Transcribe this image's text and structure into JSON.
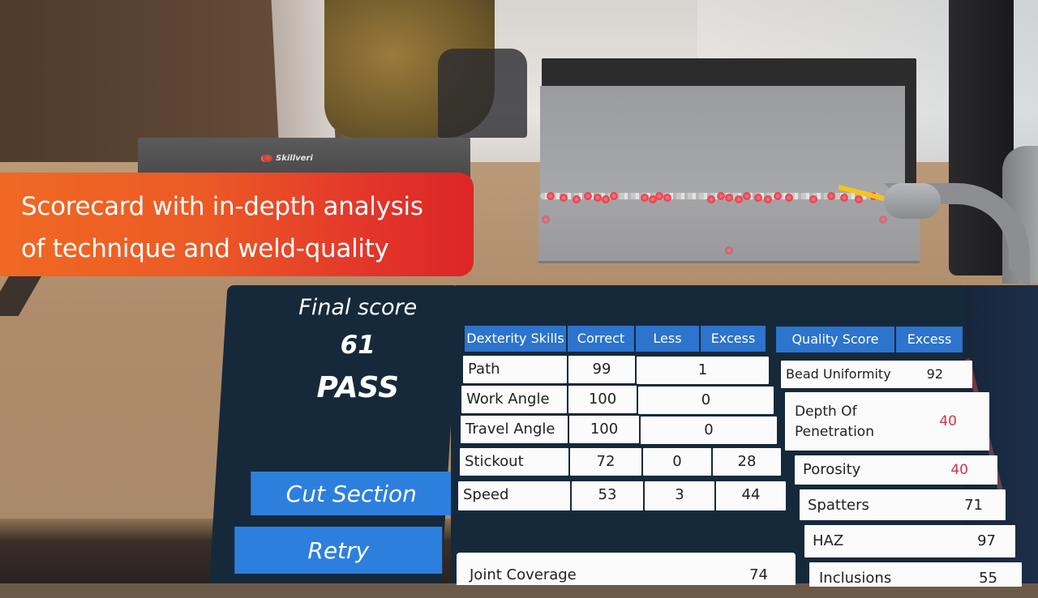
{
  "caption": {
    "line1": "Scorecard with in-depth analysis",
    "line2": "of technique and weld-quality"
  },
  "brand": {
    "name": "Skillveri"
  },
  "score_panel": {
    "label": "Final score",
    "value": "61",
    "result": "PASS",
    "buttons": {
      "cut_section": "Cut Section",
      "retry": "Retry"
    }
  },
  "dexterity": {
    "headers": [
      "Dexterity Skills",
      "Correct",
      "Less",
      "Excess"
    ],
    "rows": [
      {
        "skill": "Path",
        "correct": "99",
        "deviation": "1"
      },
      {
        "skill": "Work Angle",
        "correct": "100",
        "deviation": "0"
      },
      {
        "skill": "Travel Angle",
        "correct": "100",
        "deviation": "0"
      },
      {
        "skill": "Stickout",
        "correct": "72",
        "less": "0",
        "excess": "28"
      },
      {
        "skill": "Speed",
        "correct": "53",
        "less": "3",
        "excess": "44"
      }
    ],
    "joint_coverage": {
      "label": "Joint Coverage",
      "value": "74"
    }
  },
  "quality": {
    "headers": [
      "Quality Score",
      "Excess"
    ],
    "rows": [
      {
        "name": "Bead Uniformity",
        "value": "92",
        "status": "ok"
      },
      {
        "name_line1": "Depth Of",
        "name_line2": "Penetration",
        "value": "40",
        "status": "low"
      },
      {
        "name": "Porosity",
        "value": "40",
        "status": "low"
      },
      {
        "name": "Spatters",
        "value": "71",
        "status": "ok"
      },
      {
        "name": "HAZ",
        "value": "97",
        "status": "ok"
      },
      {
        "name": "Inclusions",
        "value": "55",
        "status": "ok"
      }
    ]
  },
  "colors": {
    "panel_bg": "#16293a",
    "header_blue": "#2c74cc",
    "button_blue": "#2d7fdd",
    "low_value_red": "#d2334a",
    "caption_orange": "#f06a24",
    "caption_red": "#dd2626"
  }
}
